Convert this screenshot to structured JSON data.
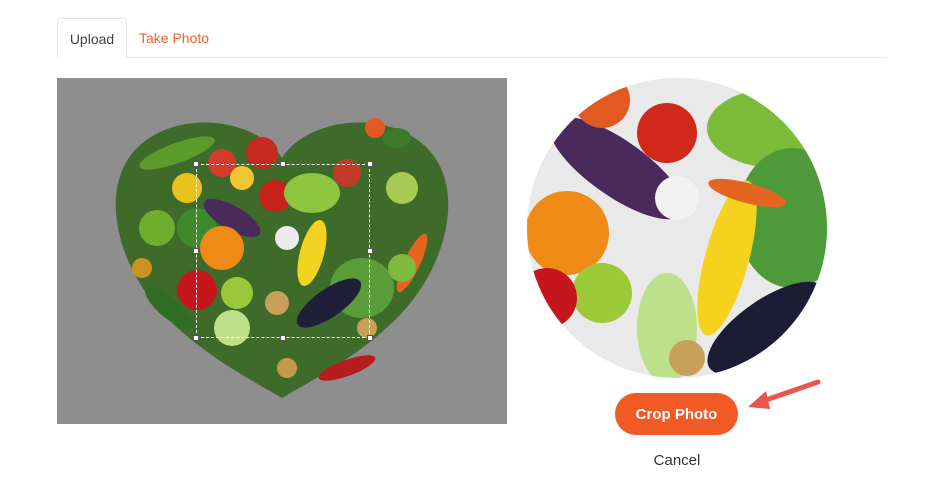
{
  "tabs": [
    {
      "label": "Upload",
      "active": true
    },
    {
      "label": "Take Photo",
      "active": false
    }
  ],
  "actions": {
    "crop_label": "Crop Photo",
    "cancel_label": "Cancel"
  },
  "colors": {
    "accent": "#f15a24",
    "tab_inactive": "#f0602a",
    "arrow": "#e8574b",
    "crop_background": "#8e8e8e"
  },
  "icons": {
    "pointer": "arrow-pointer-icon"
  }
}
